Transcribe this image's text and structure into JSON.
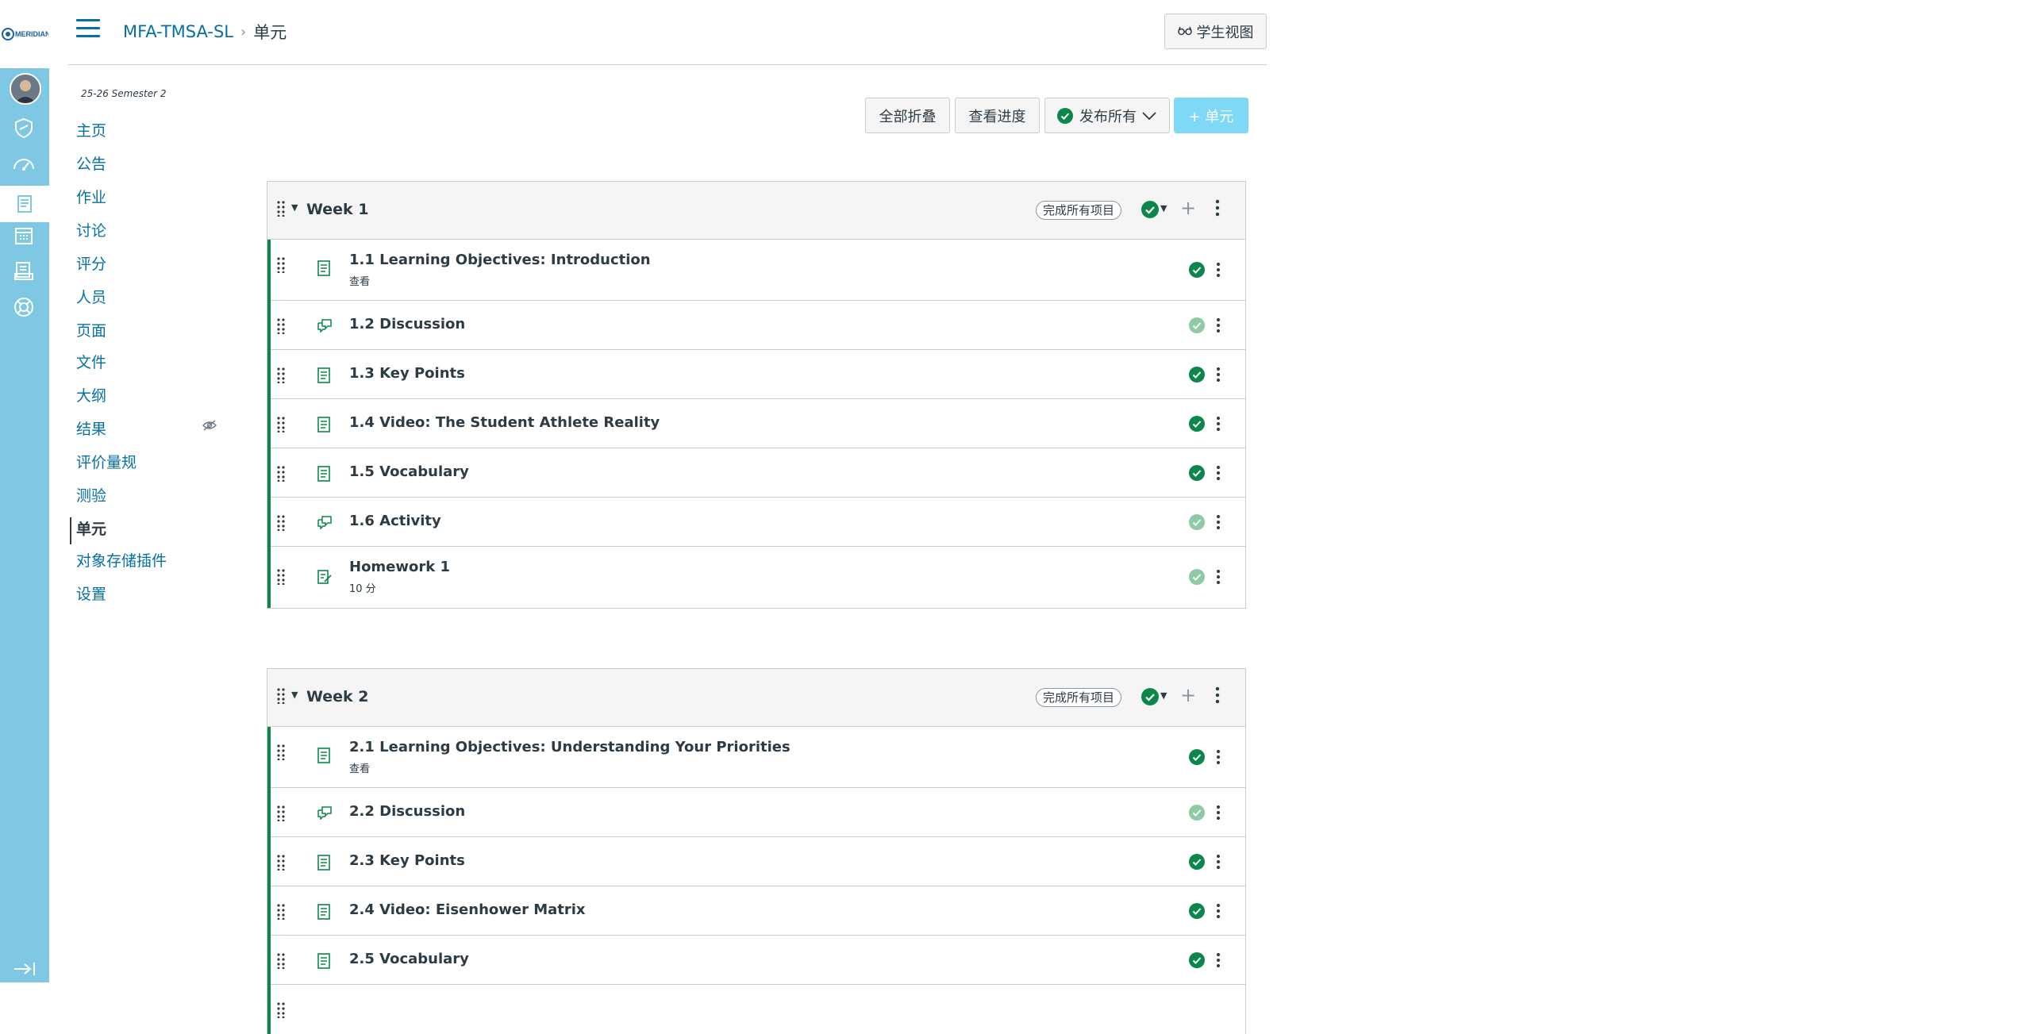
{
  "logo": {
    "text": "MERIDIAN"
  },
  "breadcrumb": {
    "course": "MFA-TMSA-SL",
    "separator": "›",
    "current": "单元"
  },
  "header": {
    "student_view": "学生视图"
  },
  "term": "25-26 Semester 2",
  "course_nav": {
    "items": [
      {
        "label": "主页",
        "active": false
      },
      {
        "label": "公告",
        "active": false
      },
      {
        "label": "作业",
        "active": false
      },
      {
        "label": "讨论",
        "active": false
      },
      {
        "label": "评分",
        "active": false
      },
      {
        "label": "人员",
        "active": false
      },
      {
        "label": "页面",
        "active": false
      },
      {
        "label": "文件",
        "active": false
      },
      {
        "label": "大纲",
        "active": false
      },
      {
        "label": "结果",
        "active": false,
        "hidden_icon": "eye-slash-icon"
      },
      {
        "label": "评价量规",
        "active": false
      },
      {
        "label": "测验",
        "active": false
      },
      {
        "label": "单元",
        "active": true
      },
      {
        "label": "对象存储插件",
        "active": false
      },
      {
        "label": "设置",
        "active": false
      }
    ]
  },
  "toolbar": {
    "collapse_all": "全部折叠",
    "view_progress": "查看进度",
    "publish_all": "发布所有",
    "add_module": "+ 单元"
  },
  "modules": [
    {
      "title": "Week 1",
      "requirement": "完成所有项目",
      "items": [
        {
          "title": "1.1 Learning Objectives: Introduction",
          "sub": "查看",
          "icon": "page-icon",
          "published": true
        },
        {
          "title": "1.2 Discussion",
          "sub": "",
          "icon": "discussion-icon",
          "published": false
        },
        {
          "title": "1.3 Key Points",
          "sub": "",
          "icon": "page-icon",
          "published": true
        },
        {
          "title": "1.4 Video: The Student Athlete Reality",
          "sub": "",
          "icon": "page-icon",
          "published": true
        },
        {
          "title": "1.5 Vocabulary",
          "sub": "",
          "icon": "page-icon",
          "published": true
        },
        {
          "title": "1.6 Activity",
          "sub": "",
          "icon": "discussion-icon",
          "published": false
        },
        {
          "title": "Homework 1",
          "sub": "10 分",
          "icon": "assignment-icon",
          "published": false
        }
      ]
    },
    {
      "title": "Week 2",
      "requirement": "完成所有项目",
      "items": [
        {
          "title": "2.1 Learning Objectives: Understanding Your Priorities",
          "sub": "查看",
          "icon": "page-icon",
          "published": true
        },
        {
          "title": "2.2 Discussion",
          "sub": "",
          "icon": "discussion-icon",
          "published": false
        },
        {
          "title": "2.3 Key Points",
          "sub": "",
          "icon": "page-icon",
          "published": true
        },
        {
          "title": "2.4 Video: Eisenhower Matrix",
          "sub": "",
          "icon": "page-icon",
          "published": true
        },
        {
          "title": "2.5 Vocabulary",
          "sub": "",
          "icon": "page-icon",
          "published": true
        },
        {
          "title": "",
          "sub": "",
          "icon": "page-icon",
          "published": true
        }
      ]
    }
  ],
  "colors": {
    "nav_bg": "#7fc8e3",
    "link": "#0770a3",
    "published": "#0b874b",
    "unpublished": "#8fcaa6",
    "add_button": "#7fd8f5"
  }
}
